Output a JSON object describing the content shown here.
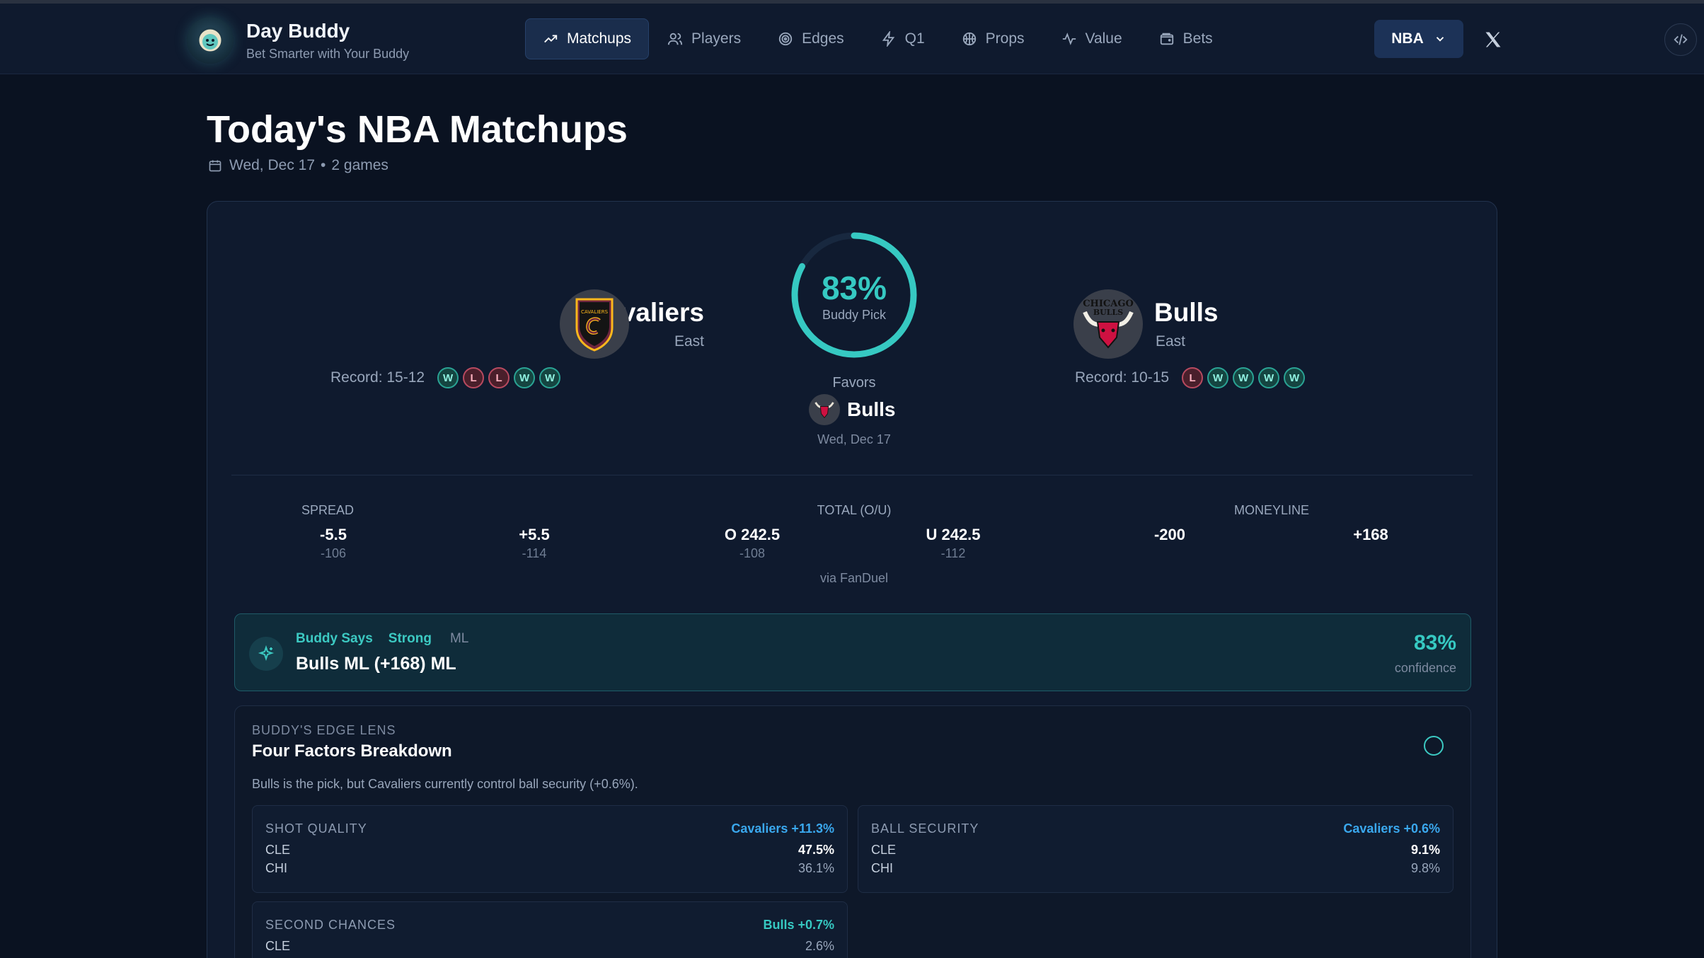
{
  "brand": {
    "name": "Day Buddy",
    "tagline": "Bet Smarter with Your Buddy"
  },
  "nav": {
    "items": [
      {
        "label": "Matchups",
        "icon": "trending-up-icon",
        "active": true
      },
      {
        "label": "Players",
        "icon": "users-icon"
      },
      {
        "label": "Edges",
        "icon": "target-icon"
      },
      {
        "label": "Q1",
        "icon": "bolt-icon"
      },
      {
        "label": "Props",
        "icon": "basketball-icon"
      },
      {
        "label": "Value",
        "icon": "pulse-icon"
      },
      {
        "label": "Bets",
        "icon": "wallet-icon"
      }
    ],
    "league": "NBA"
  },
  "page": {
    "title": "Today's NBA Matchups",
    "date": "Wed, Dec 17",
    "games": "2 games"
  },
  "matchup": {
    "home": {
      "name": "Cavaliers",
      "conference": "East",
      "record": "Record: 15-12",
      "form": [
        "W",
        "L",
        "L",
        "W",
        "W"
      ],
      "logo_text": "CLEVELAND CAVALIERS"
    },
    "away": {
      "name": "Bulls",
      "conference": "East",
      "record": "Record: 10-15",
      "form": [
        "L",
        "W",
        "W",
        "W",
        "W"
      ],
      "logo_text": "CHICAGO BULLS"
    },
    "buddy_pick": {
      "percent": "83%",
      "percent_value": 0.83,
      "label": "Buddy Pick"
    },
    "favors_label": "Favors",
    "favors_team": "Bulls",
    "date": "Wed, Dec 17"
  },
  "odds": {
    "spread": {
      "label": "SPREAD",
      "home": "-5.5",
      "home_price": "-106",
      "away": "+5.5",
      "away_price": "-114"
    },
    "total": {
      "label": "TOTAL (O/U)",
      "over": "O 242.5",
      "over_price": "-108",
      "under": "U 242.5",
      "under_price": "-112"
    },
    "moneyline": {
      "label": "MONEYLINE",
      "home": "-200",
      "away": "+168"
    },
    "source": "via FanDuel"
  },
  "buddy_says": {
    "tag": "Buddy Says",
    "strength": "Strong",
    "market": "ML",
    "pick": "Bulls ML (+168) ML",
    "confidence": "83%",
    "confidence_label": "confidence"
  },
  "edge_lens": {
    "kicker": "BUDDY'S EDGE LENS",
    "title": "Four Factors Breakdown",
    "description": "Bulls is the pick, but Cavaliers currently control ball security (+0.6%).",
    "factors": [
      {
        "name": "SHOT QUALITY",
        "edge": "Cavaliers +11.3%",
        "cle_label": "CLE",
        "cle": "47.5%",
        "chi_label": "CHI",
        "chi": "36.1%"
      },
      {
        "name": "BALL SECURITY",
        "edge": "Cavaliers +0.6%",
        "cle_label": "CLE",
        "cle": "9.1%",
        "chi_label": "CHI",
        "chi": "9.8%"
      },
      {
        "name": "SECOND CHANCES",
        "edge": "Bulls +0.7%",
        "cle_label": "CLE",
        "cle": "2.6%"
      }
    ]
  },
  "colors": {
    "accent": "#36c9c2",
    "win": "#2aa394",
    "loss": "#b84a60",
    "cavaliers_edge": "#3aa8ee"
  }
}
